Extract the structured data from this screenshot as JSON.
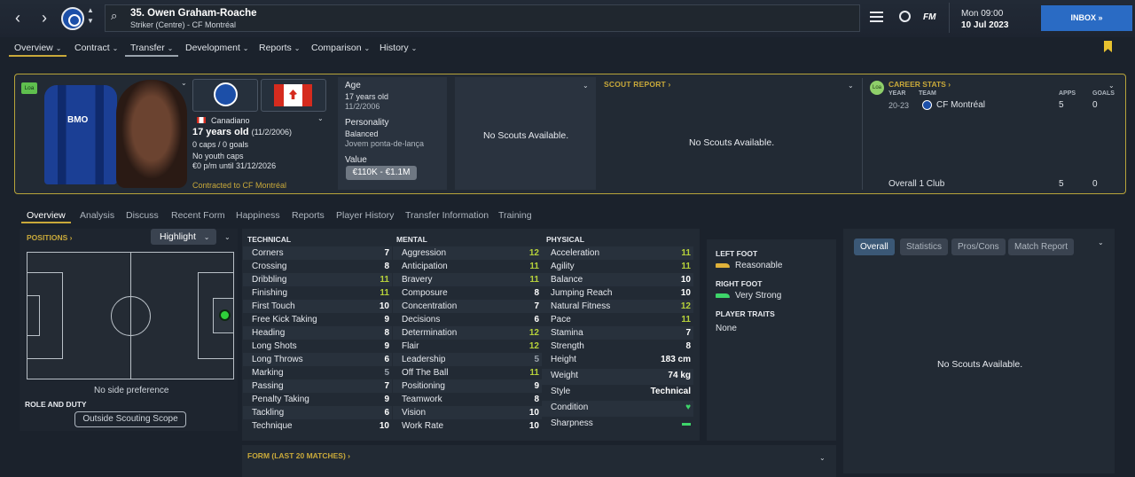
{
  "topbar": {
    "player_title": "35. Owen Graham-Roache",
    "player_subtitle": "Striker (Centre) - CF Montréal",
    "fm_logo": "FM",
    "time": "Mon 09:00",
    "date": "10 Jul 2023",
    "inbox_label": "INBOX"
  },
  "nav_tabs": [
    "Overview",
    "Contract",
    "Transfer",
    "Development",
    "Reports",
    "Comparison",
    "History"
  ],
  "header": {
    "loan_badge": "Loa",
    "shirt_sponsor": "BMO",
    "nationality": "Canadiano",
    "age_line": "17 years old",
    "dob_paren": "(11/2/2006)",
    "caps": "0 caps / 0 goals",
    "youth_caps": "No youth caps",
    "wage": "€0 p/m until 31/12/2026",
    "contracted": "Contracted to CF Montréal",
    "age_label": "Age",
    "age_value": "17 years old",
    "dob": "11/2/2006",
    "personality_label": "Personality",
    "personality_value": "Balanced",
    "media_handling": "Jovem ponta-de-lança",
    "value_label": "Value",
    "value_range": "€110K - €1.1M",
    "no_scouts": "No Scouts Available.",
    "scout_report_label": "SCOUT REPORT",
    "career_stats_label": "CAREER STATS",
    "career_cols": {
      "year": "YEAR",
      "team": "TEAM",
      "apps": "APPS",
      "goals": "GOALS"
    },
    "career_row": {
      "year": "20-23",
      "team": "CF Montréal",
      "apps": "5",
      "goals": "0"
    },
    "career_total": {
      "label": "Overall 1 Club",
      "apps": "5",
      "goals": "0"
    }
  },
  "sub_tabs": [
    "Overview",
    "Analysis",
    "Discuss",
    "Recent Form",
    "Happiness",
    "Reports",
    "Player History",
    "Transfer Information",
    "Training"
  ],
  "positions": {
    "label": "POSITIONS",
    "highlight": "Highlight",
    "side_pref": "No side preference",
    "role_duty": "ROLE AND DUTY",
    "scout_scope": "Outside Scouting Scope"
  },
  "attributes": {
    "technical_label": "TECHNICAL",
    "mental_label": "MENTAL",
    "physical_label": "PHYSICAL",
    "technical": [
      {
        "name": "Corners",
        "value": "7",
        "tone": "white"
      },
      {
        "name": "Crossing",
        "value": "8",
        "tone": "white"
      },
      {
        "name": "Dribbling",
        "value": "11",
        "tone": "green"
      },
      {
        "name": "Finishing",
        "value": "11",
        "tone": "green"
      },
      {
        "name": "First Touch",
        "value": "10",
        "tone": "white"
      },
      {
        "name": "Free Kick Taking",
        "value": "9",
        "tone": "white"
      },
      {
        "name": "Heading",
        "value": "8",
        "tone": "white"
      },
      {
        "name": "Long Shots",
        "value": "9",
        "tone": "white"
      },
      {
        "name": "Long Throws",
        "value": "6",
        "tone": "white"
      },
      {
        "name": "Marking",
        "value": "5",
        "tone": "grey"
      },
      {
        "name": "Passing",
        "value": "7",
        "tone": "white"
      },
      {
        "name": "Penalty Taking",
        "value": "9",
        "tone": "white"
      },
      {
        "name": "Tackling",
        "value": "6",
        "tone": "white"
      },
      {
        "name": "Technique",
        "value": "10",
        "tone": "white"
      }
    ],
    "mental": [
      {
        "name": "Aggression",
        "value": "12",
        "tone": "green"
      },
      {
        "name": "Anticipation",
        "value": "11",
        "tone": "green"
      },
      {
        "name": "Bravery",
        "value": "11",
        "tone": "green"
      },
      {
        "name": "Composure",
        "value": "8",
        "tone": "white"
      },
      {
        "name": "Concentration",
        "value": "7",
        "tone": "white"
      },
      {
        "name": "Decisions",
        "value": "6",
        "tone": "white"
      },
      {
        "name": "Determination",
        "value": "12",
        "tone": "green"
      },
      {
        "name": "Flair",
        "value": "12",
        "tone": "green"
      },
      {
        "name": "Leadership",
        "value": "5",
        "tone": "grey"
      },
      {
        "name": "Off The Ball",
        "value": "11",
        "tone": "green"
      },
      {
        "name": "Positioning",
        "value": "9",
        "tone": "white"
      },
      {
        "name": "Teamwork",
        "value": "8",
        "tone": "white"
      },
      {
        "name": "Vision",
        "value": "10",
        "tone": "white"
      },
      {
        "name": "Work Rate",
        "value": "10",
        "tone": "white"
      }
    ],
    "physical": [
      {
        "name": "Acceleration",
        "value": "11",
        "tone": "green"
      },
      {
        "name": "Agility",
        "value": "11",
        "tone": "green"
      },
      {
        "name": "Balance",
        "value": "10",
        "tone": "white"
      },
      {
        "name": "Jumping Reach",
        "value": "10",
        "tone": "white"
      },
      {
        "name": "Natural Fitness",
        "value": "12",
        "tone": "green"
      },
      {
        "name": "Pace",
        "value": "11",
        "tone": "green"
      },
      {
        "name": "Stamina",
        "value": "7",
        "tone": "white"
      },
      {
        "name": "Strength",
        "value": "8",
        "tone": "white"
      }
    ],
    "extra": [
      {
        "name": "Height",
        "value": "183 cm"
      },
      {
        "name": "Weight",
        "value": "74 kg"
      },
      {
        "name": "Style",
        "value": "Technical"
      },
      {
        "name": "Condition",
        "value": "♥"
      },
      {
        "name": "Sharpness",
        "value": "▬"
      }
    ]
  },
  "feet": {
    "left_label": "LEFT FOOT",
    "left_value": "Reasonable",
    "right_label": "RIGHT FOOT",
    "right_value": "Very Strong",
    "traits_label": "PLAYER TRAITS",
    "traits_value": "None"
  },
  "right_tabs": [
    "Overall",
    "Statistics",
    "Pros/Cons",
    "Match Report"
  ],
  "right_no_scouts": "No Scouts Available.",
  "form_label": "FORM (LAST 20 MATCHES)",
  "colors": {
    "accent_gold": "#c9a93a",
    "green_value": "#b7d23a",
    "inbox_blue": "#2a6bc4"
  }
}
